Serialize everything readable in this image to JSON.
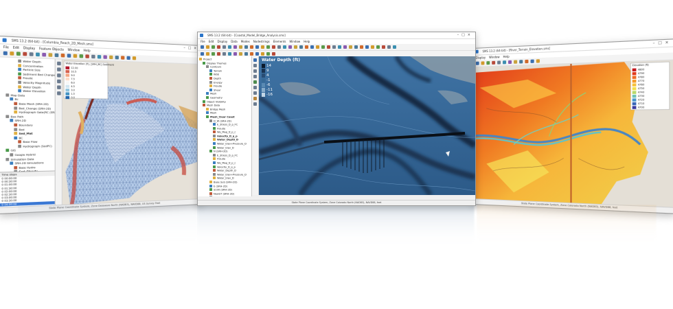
{
  "left_window": {
    "title": "SMS 13.2 (64-bit) - [Columbia_Reach_2D_Mesh.sms]",
    "menus": [
      "File",
      "Edit",
      "Display",
      "Feature Objects",
      "Window",
      "Help"
    ],
    "tree_items": [
      {
        "label": "Water Depth",
        "indent": 4
      },
      {
        "label": "Concentration",
        "indent": 4
      },
      {
        "label": "Particle Size",
        "indent": 4
      },
      {
        "label": "Sediment Bed Change",
        "indent": 4
      },
      {
        "label": "Froude",
        "indent": 4
      },
      {
        "label": "Velocity Magnitude",
        "indent": 4
      },
      {
        "label": "Water Depth",
        "indent": 4
      },
      {
        "label": "Water Elevation",
        "indent": 4
      },
      {
        "label": "Map Data",
        "indent": 1
      },
      {
        "label": "Bc",
        "indent": 2
      },
      {
        "label": "Base Mesh (SRH-2D)",
        "indent": 3
      },
      {
        "label": "Bed_Change (SRH-2D)",
        "indent": 3
      },
      {
        "label": "Hydrograph Gate(RC (SRH-2D)",
        "indent": 3
      },
      {
        "label": "Bee Path",
        "indent": 1
      },
      {
        "label": "SRH-2D",
        "indent": 2
      },
      {
        "label": "Boundary",
        "indent": 3
      },
      {
        "label": "Bed",
        "indent": 3
      },
      {
        "label": "Sed_Mat",
        "indent": 3,
        "bold": true
      },
      {
        "label": "BC",
        "indent": 3
      },
      {
        "label": "Base Flow",
        "indent": 4
      },
      {
        "label": "Hydrograph (SedPC)",
        "indent": 4
      },
      {
        "label": "GIS",
        "indent": 1
      },
      {
        "label": "Google Hybrid",
        "indent": 2
      },
      {
        "label": "Simulation Data",
        "indent": 1
      },
      {
        "label": "SRH-2D Simulations",
        "indent": 2
      },
      {
        "label": "Base Hydro",
        "indent": 3
      },
      {
        "label": "Sed_Steady",
        "indent": 3,
        "bold": true
      },
      {
        "label": "Mesh",
        "indent": 4
      },
      {
        "label": "BC",
        "indent": 4
      },
      {
        "label": "Base Flow",
        "indent": 4
      }
    ],
    "time_steps_label": "Time steps",
    "time_steps": [
      "0 00:00:00",
      "0 00:30:00",
      "0 01:00:00",
      "0 01:30:00",
      "0 02:00:00",
      "0 02:30:00",
      "0 03:00:00",
      "0 03:30:00",
      "0 04:00:00"
    ],
    "legend_title": "Water Elevation (ft), [SRH_BC] Sediment",
    "legend_values": [
      "12.00",
      "10.5",
      "9.0",
      "7.5",
      "6.0",
      "4.5",
      "3.0",
      "1.5",
      "0.0"
    ],
    "status_text": "State Plane Coordinate System, Zone Delaware North (NAD83), NAVD88, US Survey Feet"
  },
  "center_window": {
    "title": "SMS 13.2 (64-bit) - [Coastal_Model_Bridge_Analysis.sms]",
    "menus": [
      "File",
      "Edit",
      "Display",
      "Data",
      "Modes",
      "Nodestrings",
      "Elements",
      "Window",
      "Help"
    ],
    "tree_items": [
      {
        "label": "Project",
        "indent": 0
      },
      {
        "label": "Display Themes",
        "indent": 1
      },
      {
        "label": "Contours",
        "indent": 2
      },
      {
        "label": "Terrain",
        "indent": 3
      },
      {
        "label": "WSE",
        "indent": 3
      },
      {
        "label": "Depth",
        "indent": 3
      },
      {
        "label": "Energy",
        "indent": 3
      },
      {
        "label": "Froude",
        "indent": 3
      },
      {
        "label": "Shear",
        "indent": 3
      },
      {
        "label": "Mesh",
        "indent": 2
      },
      {
        "label": "Geometry",
        "indent": 2
      },
      {
        "label": "Object Visibility",
        "indent": 1
      },
      {
        "label": "Mesh Data",
        "indent": 1
      },
      {
        "label": "Bridge Mesh",
        "indent": 2
      },
      {
        "label": "Mesh",
        "indent": 2
      },
      {
        "label": "Mesh_Clear Coast",
        "indent": 2,
        "bold": true
      },
      {
        "label": "D_W (SRH-2D)",
        "indent": 3
      },
      {
        "label": "E_Stress_D_p_FC",
        "indent": 4
      },
      {
        "label": "Froude",
        "indent": 4
      },
      {
        "label": "Wa_Mag_D_p_c",
        "indent": 4
      },
      {
        "label": "Velocity_D_p_p",
        "indent": 4,
        "bold": true
      },
      {
        "label": "Water_Depth_D",
        "indent": 4,
        "bold": true
      },
      {
        "label": "Water_Elev+Pressure_D",
        "indent": 4
      },
      {
        "label": "Water_Elev_D",
        "indent": 4
      },
      {
        "label": "N (SRH-2D)",
        "indent": 3
      },
      {
        "label": "E_Stress_D_p_FC",
        "indent": 4
      },
      {
        "label": "Froude",
        "indent": 4
      },
      {
        "label": "Wa_Mag_D_p_c",
        "indent": 4
      },
      {
        "label": "Velocity_D_p_p",
        "indent": 4
      },
      {
        "label": "Water_Depth_D",
        "indent": 4
      },
      {
        "label": "Water_Elev+Pressure_D",
        "indent": 4
      },
      {
        "label": "Water_Elev_D",
        "indent": 4
      },
      {
        "label": "Base Sub (SRH-2D)",
        "indent": 3
      },
      {
        "label": "E (SRH-2D)",
        "indent": 3
      },
      {
        "label": "S100 (SRH-2D)",
        "indent": 3
      },
      {
        "label": "NewST (SRH-2D)",
        "indent": 3
      },
      {
        "label": "S50 (SRH-2D)",
        "indent": 3
      },
      {
        "label": "Other Data",
        "indent": 1
      },
      {
        "label": "2D Bridge",
        "indent": 2,
        "bold": true
      },
      {
        "label": "2D Bridge Piers",
        "indent": 3
      },
      {
        "label": "2D Bridge Deck",
        "indent": 3
      }
    ],
    "legend_title": "Water Depth (ft)",
    "legend_values": [
      "14",
      "9",
      "4",
      "-1",
      "-6",
      "-11",
      "-16"
    ],
    "status_text": "State Plane Coordinate System, Zone Colorado North (NAD83), NAVD88, feet"
  },
  "right_window": {
    "title": "SMS 13.2 (64-bit) - [River_Terrain_Elevation.sms]",
    "menus": [
      "Display",
      "Window",
      "Help"
    ],
    "legend_title": "Elevation (ft)",
    "legend_values": [
      "4800",
      "4790",
      "4780",
      "4770",
      "4760",
      "4750",
      "4740",
      "4730",
      "4720",
      "4710",
      "4700"
    ],
    "status_text": "State Plane Coordinate System, Zone Colorado North (NAD83), NAVD88, feet"
  },
  "colors": {
    "water_blue": "#2f5f8f",
    "dark_channel": "#18304a",
    "terrain_red": "#d43a1c",
    "terrain_orange": "#ef8a22",
    "terrain_yellow": "#f2c33a",
    "mesh_blue": "#a9c4e6"
  }
}
